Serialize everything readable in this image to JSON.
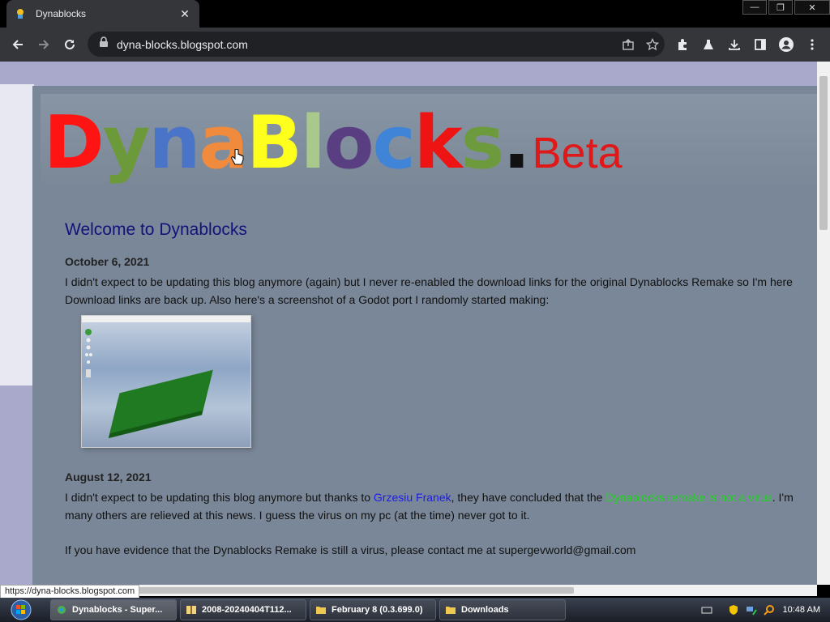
{
  "browser": {
    "tab_title": "Dynablocks",
    "tab_close": "✕",
    "url": "dyna-blocks.blogspot.com",
    "status_url": "https://dyna-blocks.blogspot.com"
  },
  "window_controls": {
    "minimize": "—",
    "restore": "❐",
    "close": "✕"
  },
  "logo": {
    "letters": [
      {
        "char": "D",
        "color": "#ff1414"
      },
      {
        "char": "y",
        "color": "#6c9a3a"
      },
      {
        "char": "n",
        "color": "#4a74c8"
      },
      {
        "char": "a",
        "color": "#f08a3c"
      },
      {
        "char": "B",
        "color": "#ffff1e"
      },
      {
        "char": "l",
        "color": "#a9c98c"
      },
      {
        "char": "o",
        "color": "#5a3e82"
      },
      {
        "char": "c",
        "color": "#3f84d6"
      },
      {
        "char": "k",
        "color": "#ee1414"
      },
      {
        "char": "s",
        "color": "#6d9a3c"
      },
      {
        "char": ".",
        "color": "#111111"
      }
    ],
    "suffix": "Beta"
  },
  "blog": {
    "title": "Welcome to Dynablocks",
    "posts": [
      {
        "date": "October 6, 2021",
        "line1": "I didn't expect to be updating this blog anymore (again) but I never re-enabled the download links for the original Dynablocks Remake so I'm here",
        "line2": "Download links are back up. Also here's a screenshot of a Godot port I randomly started making:"
      },
      {
        "date": "August 12, 2021",
        "line1_before": "I didn't expect to be updating this blog anymore but thanks to ",
        "link1": "Grzesiu Franek",
        "line1_middle": ", they have concluded that the ",
        "link2": "Dynablocks remake is not a virus",
        "line1_after": ". I'm",
        "line2": "many others are relieved at this news. I guess the virus on my pc (at the time) never got to it.",
        "line3": "If you have evidence that the Dynablocks Remake is still a virus, please contact me at supergevworld@gmail.com"
      }
    ]
  },
  "taskbar": {
    "items": [
      {
        "label": "Dynablocks - Super...",
        "active": true
      },
      {
        "label": "2008-20240404T112..."
      },
      {
        "label": "February 8 (0.3.699.0)"
      },
      {
        "label": "Downloads"
      }
    ],
    "clock": "10:48 AM"
  }
}
